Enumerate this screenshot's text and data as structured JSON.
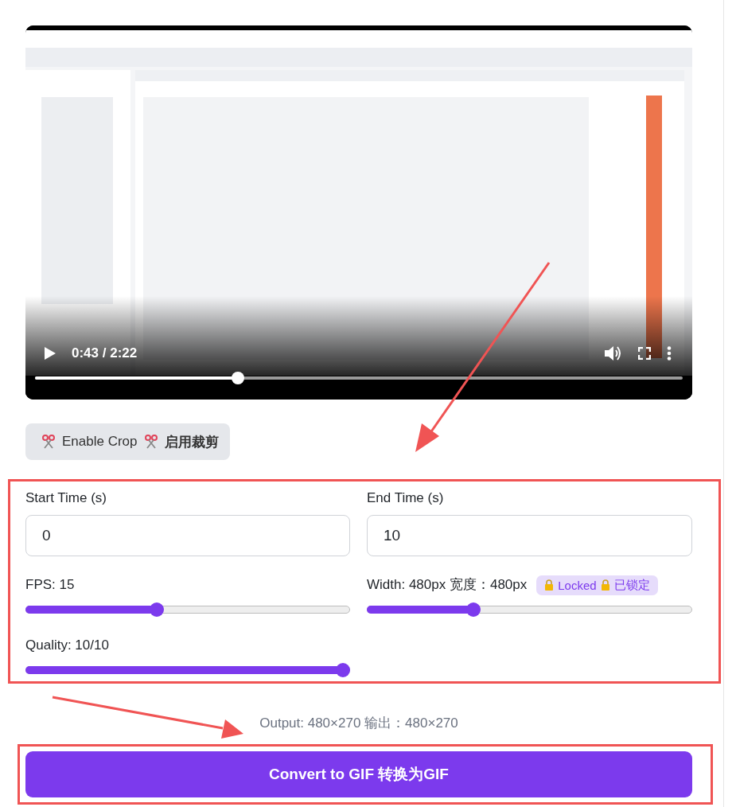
{
  "video": {
    "time": "0:43 / 2:22",
    "level": 0.31
  },
  "crop_button": {
    "label": "Enable Crop",
    "label_zh": "启用裁剪"
  },
  "fields": [
    {
      "label": "Start Time (s)",
      "value": "0"
    },
    {
      "label": "End Time (s)",
      "value": "10"
    }
  ],
  "sliders": [
    {
      "label": "FPS: 15",
      "level": 0.4
    },
    {
      "label": "Width: 480px 宽度：480px",
      "level": 0.32,
      "badge": {
        "label": "Locked",
        "label_zh": "已锁定"
      }
    },
    {
      "label": "Quality: 10/10",
      "level": 1.0
    }
  ],
  "output": "Output: 480×270 输出：480×270",
  "convert_button": "Convert to GIF 转换为GIF"
}
